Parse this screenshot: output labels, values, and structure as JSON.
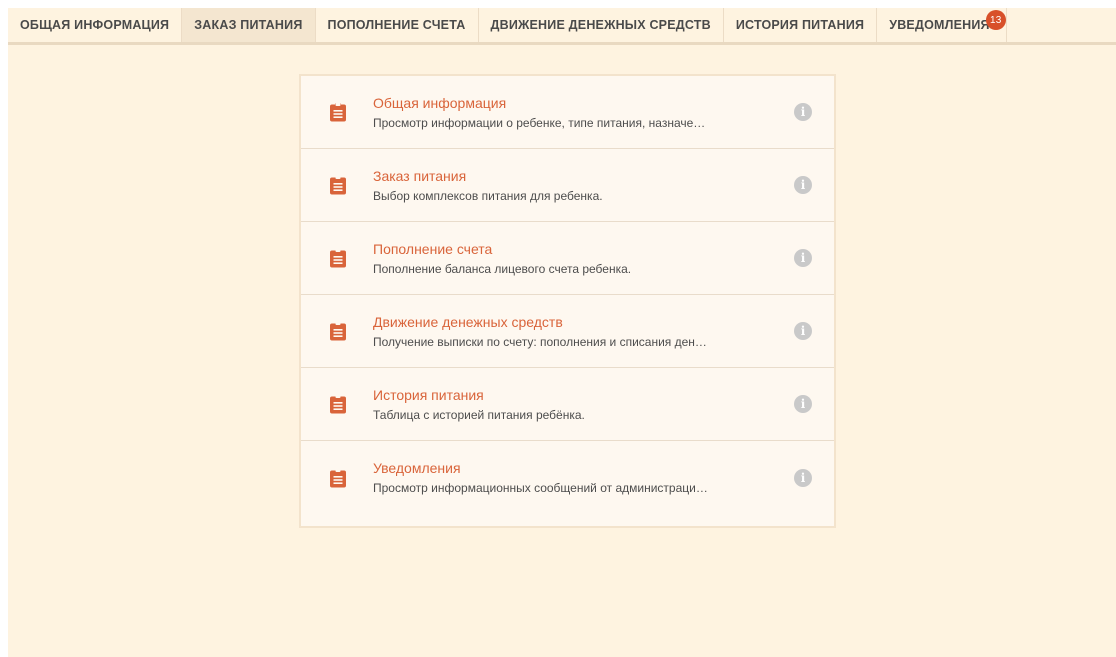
{
  "tabs": [
    {
      "label": "Общая информация"
    },
    {
      "label": "Заказ питания"
    },
    {
      "label": "Пополнение счета"
    },
    {
      "label": "Движение денежных средств"
    },
    {
      "label": "История питания"
    },
    {
      "label": "Уведомления",
      "badge": "13"
    }
  ],
  "active_tab": "Заказ питания",
  "colors": {
    "accent": "#d9643a",
    "badge": "#d8502a",
    "background": "#fef3e0"
  },
  "menu": [
    {
      "title": "Общая информация",
      "description": "Просмотр информации о ребенке, типе питания, назначе…",
      "icon": "clipboard-icon"
    },
    {
      "title": "Заказ питания",
      "description": "Выбор комплексов питания для ребенка.",
      "icon": "clipboard-icon"
    },
    {
      "title": "Пополнение счета",
      "description": "Пополнение баланса лицевого счета ребенка.",
      "icon": "clipboard-icon"
    },
    {
      "title": "Движение денежных средств",
      "description": "Получение выписки по счету: пополнения и списания ден…",
      "icon": "clipboard-icon"
    },
    {
      "title": "История питания",
      "description": "Таблица с историей питания ребёнка.",
      "icon": "clipboard-icon"
    },
    {
      "title": "Уведомления",
      "description": "Просмотр информационных сообщений от администраци…",
      "icon": "clipboard-icon"
    }
  ]
}
